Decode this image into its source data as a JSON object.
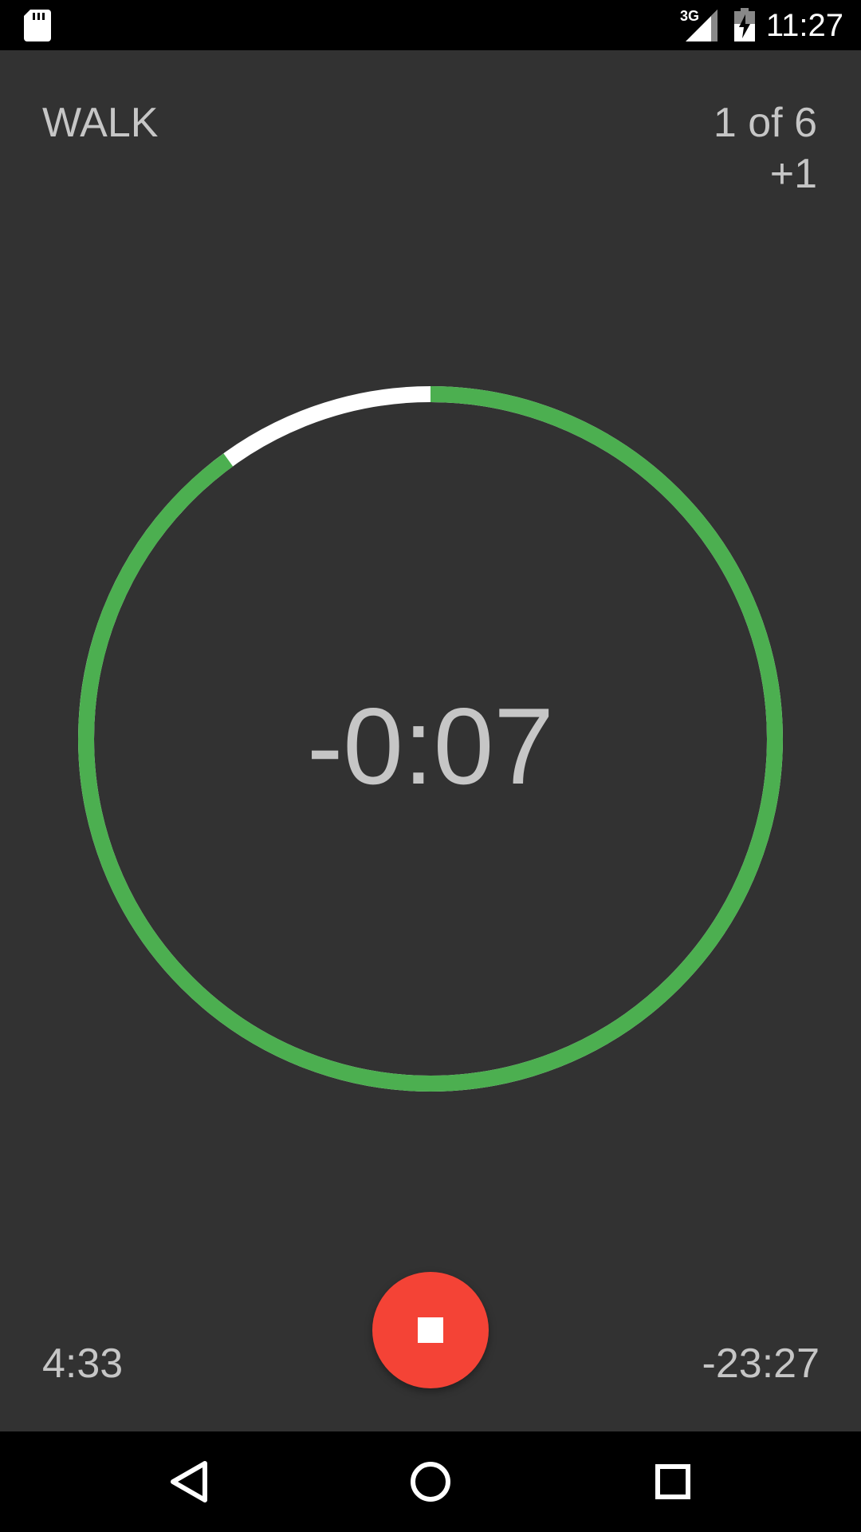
{
  "status_bar": {
    "network": "3G",
    "time": "11:27",
    "icons": [
      "sd-card-icon",
      "signal-icon",
      "battery-charging-icon"
    ]
  },
  "workout": {
    "phase": "WALK",
    "interval_counter": "1 of 6",
    "extra": "+1",
    "countdown": "-0:07",
    "elapsed": "4:33",
    "remaining": "-23:27",
    "progress_fraction": 0.9
  },
  "controls": {
    "stop_icon": "stop-icon"
  },
  "nav_bar": {
    "icons": [
      "back-icon",
      "home-icon",
      "recents-icon"
    ]
  },
  "colors": {
    "background": "#323232",
    "ring_active": "#4caf50",
    "ring_remaining": "#ffffff",
    "stop_button": "#f44336",
    "text": "#c6c6c6"
  }
}
